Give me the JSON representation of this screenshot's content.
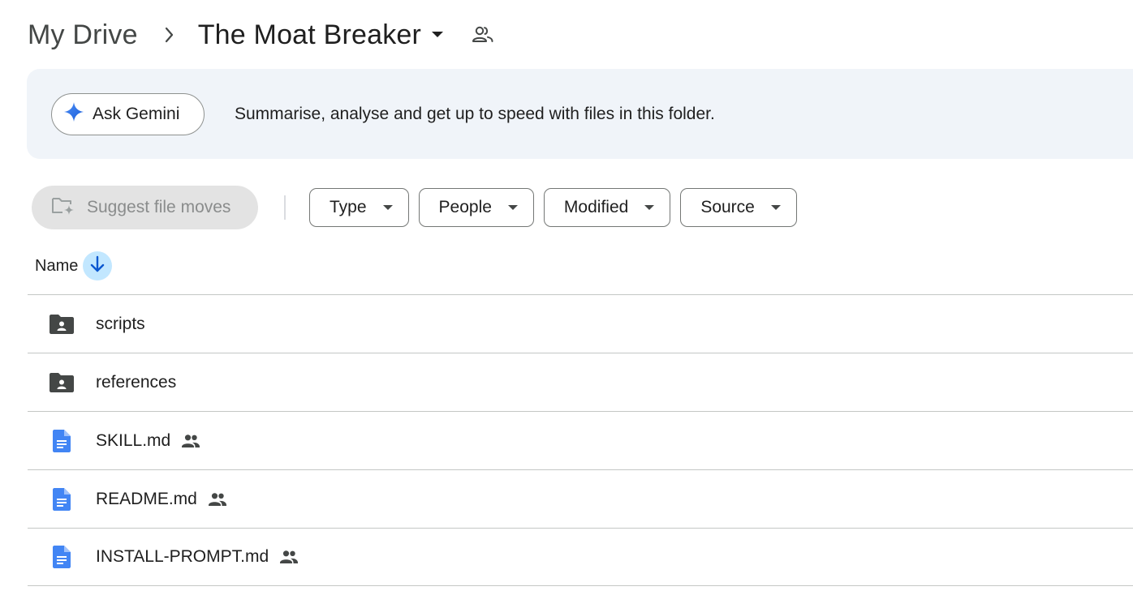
{
  "breadcrumb": {
    "root": "My Drive",
    "current": "The Moat Breaker",
    "icons": {
      "separator": "chevron-right-icon",
      "caret": "caret-down-icon",
      "shared": "shared-people-icon"
    }
  },
  "gemini": {
    "button_label": "Ask Gemini",
    "description": "Summarise, analyse and get up to speed with files in this folder.",
    "icon": "gemini-sparkle-icon",
    "accent": "#4285f4"
  },
  "filters": {
    "suggest_label": "Suggest file moves",
    "chips": [
      {
        "label": "Type"
      },
      {
        "label": "People"
      },
      {
        "label": "Modified"
      },
      {
        "label": "Source"
      }
    ]
  },
  "list": {
    "column_name": "Name",
    "sort_direction": "descending",
    "items": [
      {
        "name": "scripts",
        "type": "shared-folder",
        "shared": false
      },
      {
        "name": "references",
        "type": "shared-folder",
        "shared": false
      },
      {
        "name": "SKILL.md",
        "type": "document",
        "shared": true
      },
      {
        "name": "README.md",
        "type": "document",
        "shared": true
      },
      {
        "name": "INSTALL-PROMPT.md",
        "type": "document",
        "shared": true
      }
    ]
  },
  "colors": {
    "banner_bg": "#f0f4f9",
    "sort_bg": "#c2e7ff",
    "doc_blue": "#4285f4",
    "folder_gray": "#444746"
  }
}
